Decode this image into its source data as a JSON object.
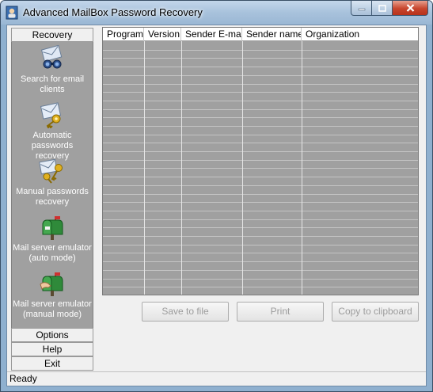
{
  "window": {
    "title": "Advanced MailBox Password Recovery",
    "icon": "user-key-icon",
    "caption_buttons": [
      "minimize-icon",
      "maximize-icon",
      "close-icon"
    ]
  },
  "sidebar": {
    "recovery_label": "Recovery",
    "items": [
      {
        "icon": "search-envelopes-icon",
        "line1": "Search for email",
        "line2": "clients"
      },
      {
        "icon": "envelope-key-icon",
        "line1": "Automatic passwords",
        "line2": "recovery"
      },
      {
        "icon": "envelope-keys-icon",
        "line1": "Manual passwords",
        "line2": "recovery"
      },
      {
        "icon": "mailbox-icon",
        "line1": "Mail server emulator",
        "line2": "(auto mode)"
      },
      {
        "icon": "mailbox-hand-icon",
        "line1": "Mail server emulator",
        "line2": "(manual mode)"
      }
    ],
    "options_label": "Options",
    "help_label": "Help",
    "exit_label": "Exit"
  },
  "table": {
    "columns": [
      "Program",
      "Version",
      "Sender E-mail",
      "Sender name",
      "Organization"
    ],
    "rows": []
  },
  "buttons": {
    "save": "Save to file",
    "print": "Print",
    "copy": "Copy to clipboard"
  },
  "status": {
    "text": "Ready"
  }
}
